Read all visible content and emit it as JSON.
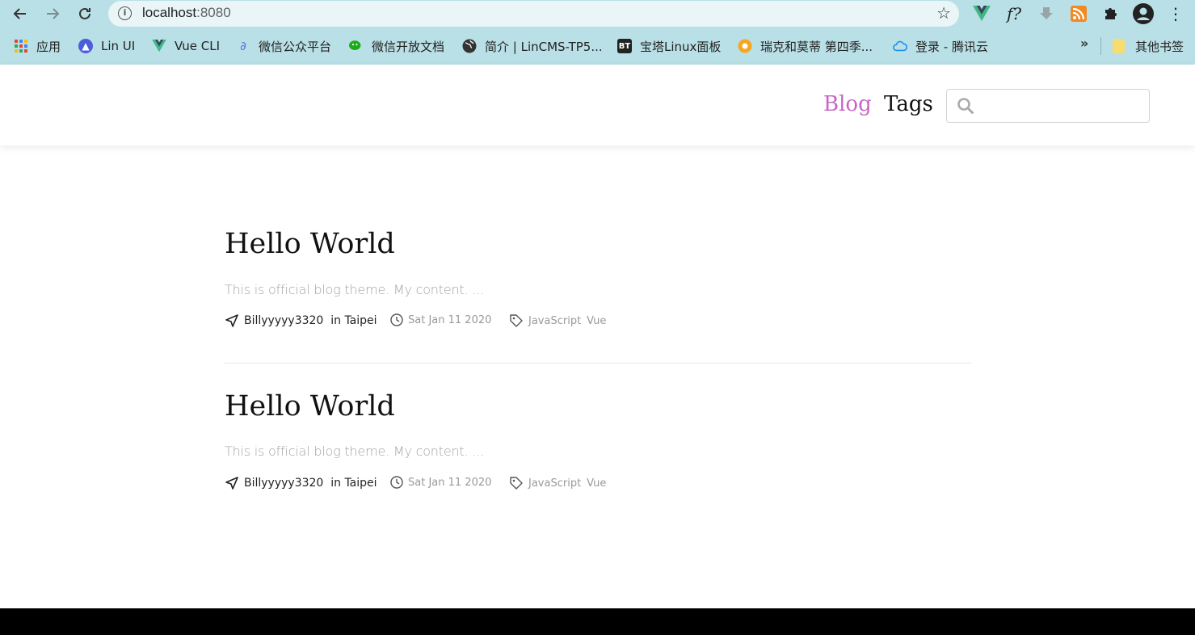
{
  "browser": {
    "url_host": "localhost",
    "url_port": ":8080",
    "bookmarks": [
      {
        "label": "应用",
        "icon": "apps-grid-icon"
      },
      {
        "label": "Lin UI",
        "icon": "lin-ui-icon"
      },
      {
        "label": "Vue CLI",
        "icon": "vue-icon"
      },
      {
        "label": "微信公众平台",
        "icon": "link-icon"
      },
      {
        "label": "微信开放文档",
        "icon": "wechat-icon"
      },
      {
        "label": "简介 | LinCMS-TP5...",
        "icon": "globe-icon"
      },
      {
        "label": "宝塔Linux面板",
        "icon": "bt-icon"
      },
      {
        "label": "瑞克和莫蒂 第四季...",
        "icon": "video-icon"
      },
      {
        "label": "登录 - 腾讯云",
        "icon": "cloud-icon"
      }
    ],
    "more_label": "»",
    "other_bookmarks": "其他书签",
    "bt_text": "BT",
    "fx_text": "f?"
  },
  "nav": {
    "blog": "Blog",
    "tags": "Tags",
    "search_value": ""
  },
  "posts": [
    {
      "title": "Hello World",
      "excerpt": "This is official blog theme. My content. ...",
      "author": "Billyyyyy3320  in Taipei",
      "date": "Sat Jan 11 2020",
      "tags": [
        "JavaScript",
        "Vue"
      ]
    },
    {
      "title": "Hello World",
      "excerpt": "This is official blog theme. My content. ...",
      "author": "Billyyyyy3320  in Taipei",
      "date": "Sat Jan 11 2020",
      "tags": [
        "JavaScript",
        "Vue"
      ]
    }
  ],
  "colors": {
    "accent": "#c765c5",
    "chrome": "#b9e0e6"
  }
}
